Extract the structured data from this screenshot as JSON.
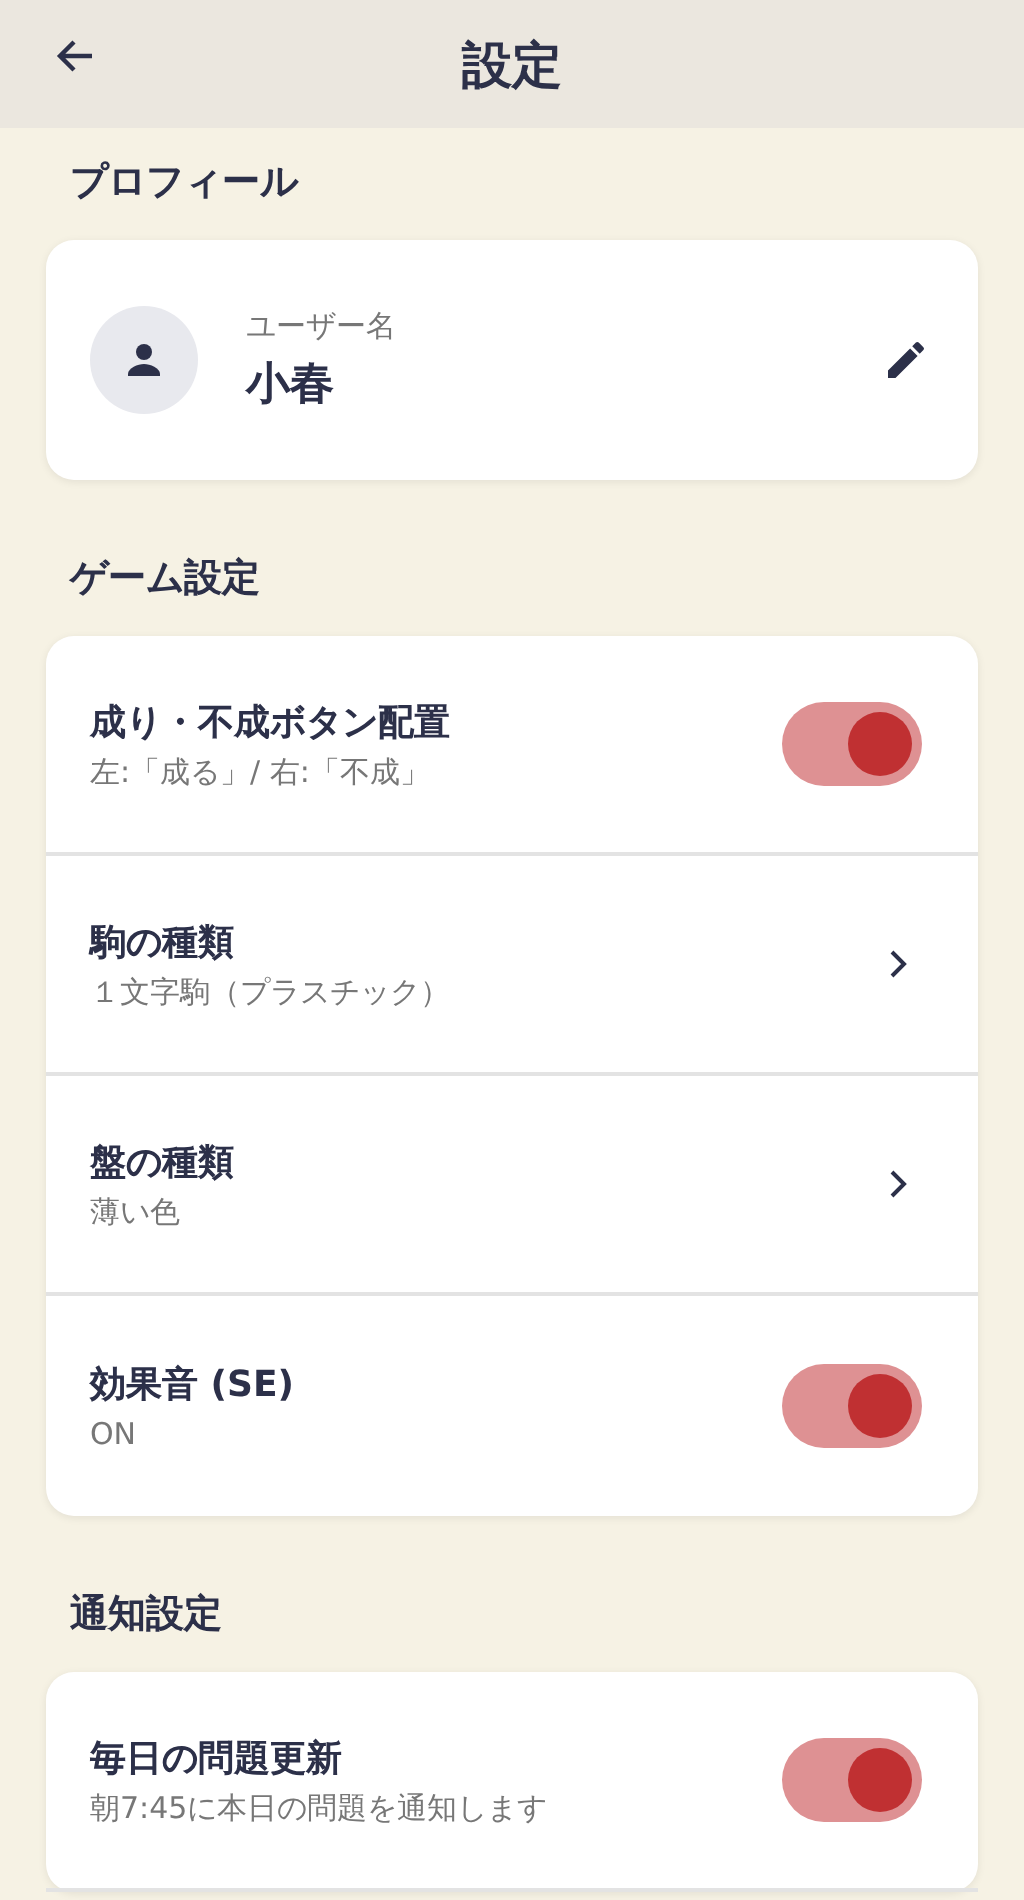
{
  "header": {
    "title": "設定"
  },
  "sections": [
    {
      "heading": "プロフィール",
      "kind": "profile",
      "profile": {
        "label": "ユーザー名",
        "name": "小春"
      }
    },
    {
      "heading": "ゲーム設定",
      "kind": "list",
      "rows": [
        {
          "kind": "toggle",
          "title": "成り・不成ボタン配置",
          "subtitle": "左:「成る」/ 右:「不成」",
          "on": true
        },
        {
          "kind": "link",
          "title": "駒の種類",
          "subtitle": "１文字駒（プラスチック）"
        },
        {
          "kind": "link",
          "title": "盤の種類",
          "subtitle": "薄い色"
        },
        {
          "kind": "toggle",
          "title": "効果音 (SE)",
          "subtitle": "ON",
          "on": true
        }
      ]
    },
    {
      "heading": "通知設定",
      "kind": "list",
      "rows": [
        {
          "kind": "toggle",
          "title": "毎日の問題更新",
          "subtitle": "朝7:45に本日の問題を通知します",
          "on": true
        }
      ]
    }
  ]
}
